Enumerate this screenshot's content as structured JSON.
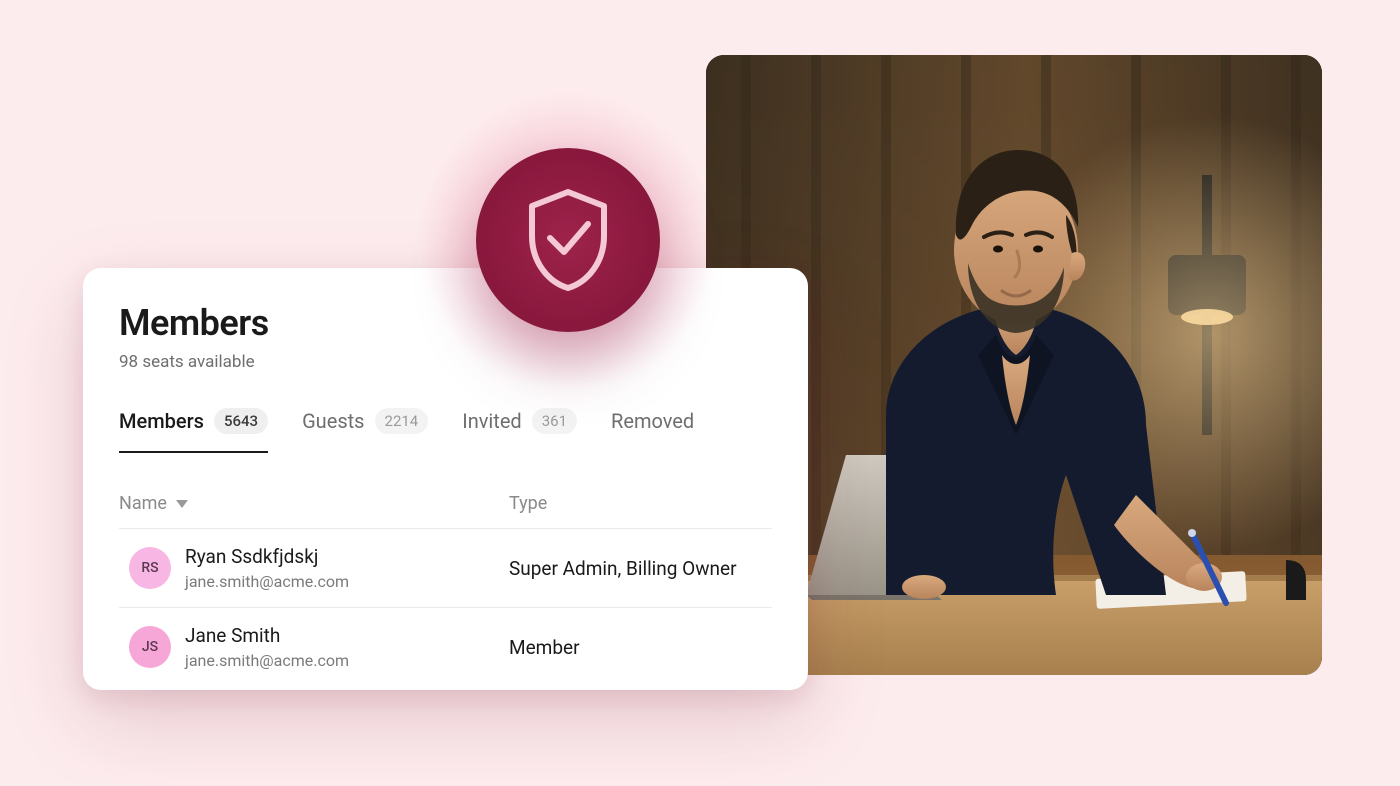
{
  "card": {
    "title": "Members",
    "subtitle": "98 seats available"
  },
  "tabs": [
    {
      "label": "Members",
      "count": "5643",
      "active": true
    },
    {
      "label": "Guests",
      "count": "2214",
      "active": false
    },
    {
      "label": "Invited",
      "count": "361",
      "active": false
    },
    {
      "label": "Removed",
      "count": "",
      "active": false
    }
  ],
  "columns": {
    "name": "Name",
    "type": "Type"
  },
  "rows": [
    {
      "initials": "RS",
      "name": "Ryan Ssdkfjdskj",
      "email": "jane.smith@acme.com",
      "type": "Super Admin, Billing Owner",
      "avatarClass": "pink-a"
    },
    {
      "initials": "JS",
      "name": "Jane Smith",
      "email": "jane.smith@acme.com",
      "type": "Member",
      "avatarClass": "pink-b"
    }
  ],
  "icons": {
    "shield": "shield-check-icon",
    "sort": "sort-desc-icon"
  }
}
